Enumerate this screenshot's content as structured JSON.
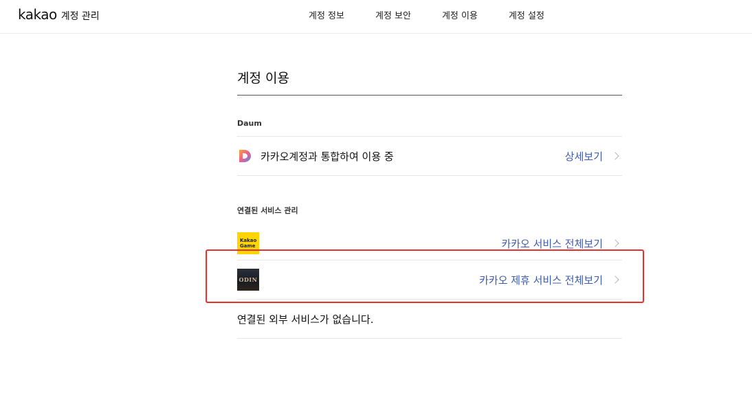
{
  "header": {
    "logo_word": "kakao",
    "logo_sub": "계정 관리",
    "nav": [
      {
        "label": "계정 정보"
      },
      {
        "label": "계정 보안"
      },
      {
        "label": "계정 이용"
      },
      {
        "label": "계정 설정"
      }
    ]
  },
  "main": {
    "title": "계정 이용",
    "daum_section": {
      "label": "Daum",
      "row_text": "카카오계정과 통합하여 이용 중",
      "link": "상세보기"
    },
    "linked_section": {
      "label": "연결된 서비스 관리",
      "rows": [
        {
          "icon": "kakao-game-icon",
          "icon_text_1": "Kakao",
          "icon_text_2": "Game",
          "link": "카카오 서비스 전체보기"
        },
        {
          "icon": "odin-icon",
          "icon_text_1": "ODIN",
          "link": "카카오 제휴 서비스 전체보기"
        }
      ]
    },
    "external_empty": "연결된 외부 서비스가 없습니다."
  },
  "colors": {
    "link": "#3c5cb4",
    "highlight": "#e8312e",
    "kakao_yellow": "#ffd400"
  }
}
